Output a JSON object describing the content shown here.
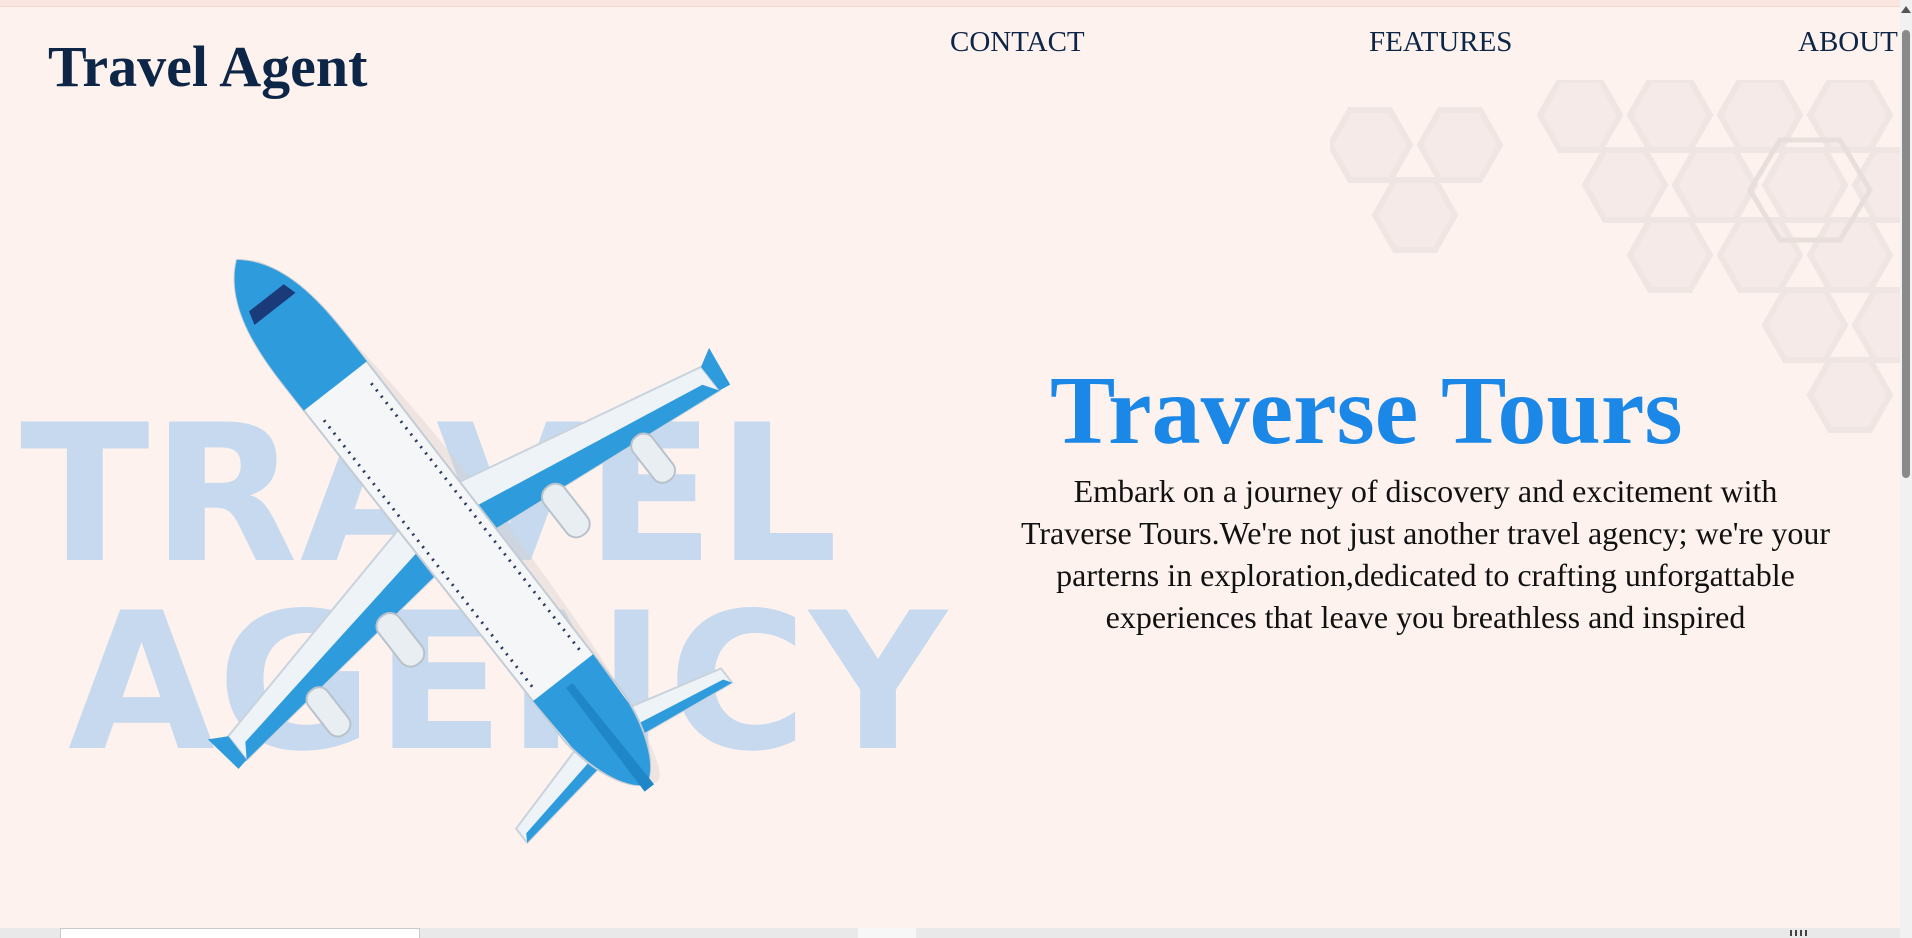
{
  "header": {
    "brand": "Travel Agent",
    "nav": [
      "CONTACT",
      "FEATURES",
      "ABOUT"
    ]
  },
  "watermark": {
    "line1": "TRAVEL",
    "line2": "AGENCY"
  },
  "hero": {
    "title": "Traverse Tours",
    "description": "Embark on a journey of discovery and excitement with Traverse Tours.We're not just another travel agency; we're your parterns in exploration,dedicated to crafting unforgattable experiences that leave you breathless and inspired"
  },
  "colors": {
    "background": "#fdf2ee",
    "brand_text": "#0d2647",
    "accent_blue": "#1b87e6",
    "watermark": "#c6d9ee"
  },
  "icons": [
    "airplane-image",
    "hexagon-pattern"
  ]
}
